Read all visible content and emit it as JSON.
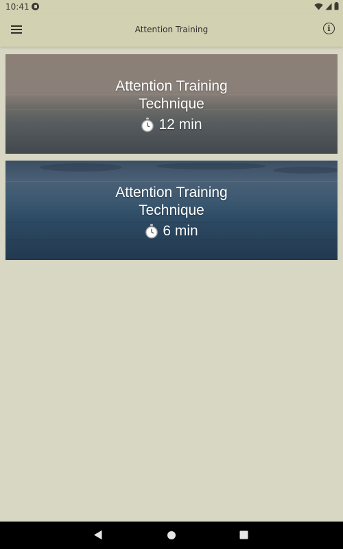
{
  "status_bar": {
    "time": "10:41",
    "icons": [
      "app-notification-icon",
      "wifi-icon",
      "signal-icon",
      "battery-icon"
    ]
  },
  "app_bar": {
    "title": "Attention Training",
    "menu_icon": "hamburger-menu-icon",
    "info_icon": "info-icon",
    "info_glyph": "i"
  },
  "sessions": [
    {
      "title_line1": "Attention Training",
      "title_line2": "Technique",
      "duration": "12 min",
      "icon": "stopwatch-icon"
    },
    {
      "title_line1": "Attention Training",
      "title_line2": "Technique",
      "duration": "6 min",
      "icon": "stopwatch-icon"
    }
  ],
  "nav_bar": {
    "buttons": [
      "back-icon",
      "home-icon",
      "recents-icon"
    ]
  },
  "colors": {
    "background": "#d8d7c3",
    "app_bar": "#d2d1b2",
    "text_dark": "#2e2e2a",
    "card_text": "#ffffff"
  }
}
